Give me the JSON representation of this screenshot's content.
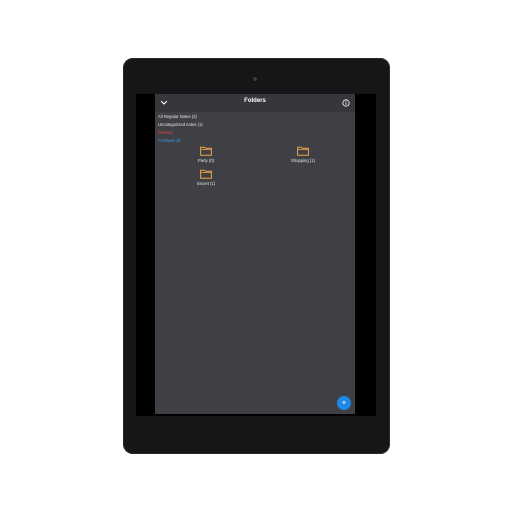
{
  "header": {
    "title": "Folders",
    "back_icon": "chevron-down-icon",
    "info_icon": "info-icon"
  },
  "list": {
    "all_regular_notes": "All Regular Notes (3)",
    "uncategorized_notes": "Uncategorized notes (1)",
    "deleted": "Deleted",
    "archived": "Archived (2)"
  },
  "folders": [
    {
      "label": "Party (0)",
      "icon": "folder-icon"
    },
    {
      "label": "Shopping (1)",
      "icon": "folder-icon"
    },
    {
      "label": "Secret (1)",
      "icon": "folder-icon"
    }
  ],
  "fab": {
    "label": "+"
  },
  "colors": {
    "background": "#3f4045",
    "appbar": "#36373b",
    "folder_accent": "#f0a04b",
    "deleted_text": "#e0463b",
    "archived_text": "#3aa1e8",
    "fab": "#1e88e5"
  }
}
